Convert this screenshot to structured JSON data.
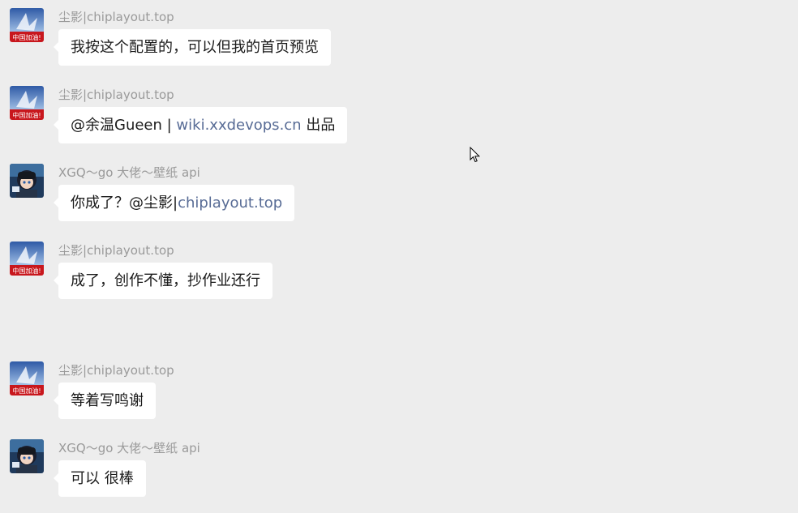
{
  "messages": [
    {
      "sender": "尘影|chiplayout.top",
      "avatar": "china-banner-avatar",
      "parts": [
        {
          "text": "我按这个配置的，可以但我的首页预览",
          "link": false
        }
      ]
    },
    {
      "sender": "尘影|chiplayout.top",
      "avatar": "china-banner-avatar",
      "parts": [
        {
          "text": "@余温Gueen | ",
          "link": false
        },
        {
          "text": "wiki.xxdevops.cn",
          "link": true
        },
        {
          "text": " 出品",
          "link": false
        }
      ]
    },
    {
      "sender": "XGQ～go 大佬～壁纸 api",
      "avatar": "anime-character-avatar",
      "parts": [
        {
          "text": "你成了？@尘影|",
          "link": false
        },
        {
          "text": "chiplayout.top",
          "link": true
        }
      ]
    },
    {
      "sender": "尘影|chiplayout.top",
      "avatar": "china-banner-avatar",
      "parts": [
        {
          "text": "成了，创作不懂，抄作业还行",
          "link": false
        }
      ]
    },
    {
      "sender": "尘影|chiplayout.top",
      "avatar": "china-banner-avatar",
      "parts": [
        {
          "text": "等着写鸣谢",
          "link": false
        }
      ]
    },
    {
      "sender": "XGQ～go 大佬～壁纸 api",
      "avatar": "anime-character-avatar",
      "parts": [
        {
          "text": "可以 很棒",
          "link": false
        }
      ]
    }
  ],
  "avatar_badge_text": "中国加油!",
  "colors": {
    "background": "#ededed",
    "bubble": "#ffffff",
    "sender": "#9a9a9a",
    "link": "#576b95"
  }
}
